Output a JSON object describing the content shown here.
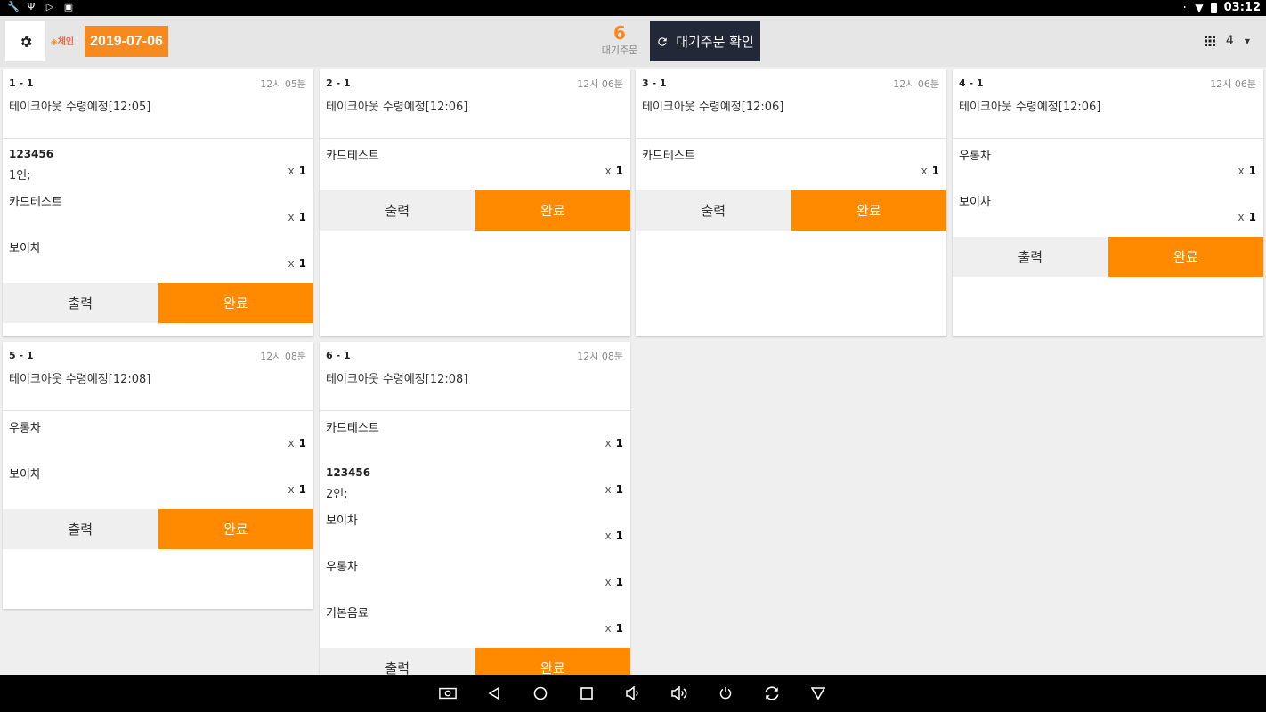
{
  "statusbar": {
    "left_icons": [
      "wrench-icon",
      "usb-icon",
      "play-store-icon",
      "app-icon"
    ],
    "right_icons": [
      "bluetooth-icon",
      "wifi-icon",
      "battery-icon"
    ],
    "time": "03:12"
  },
  "header": {
    "settings_icon": "gear-icon",
    "logo_text": "체인",
    "date": "2019-07-06",
    "pending_count": "6",
    "pending_label": "대기주문",
    "confirm_label": "대기주문 확인",
    "confirm_icon": "refresh-icon",
    "grid_value": "4",
    "grid_icon": "grid-icon"
  },
  "labels": {
    "qty_prefix": "x",
    "print": "출력",
    "done": "완료"
  },
  "orders": [
    {
      "number": "1 - 1",
      "time": "12시 05분",
      "desc": "테이크아웃 수령예정[12:05]",
      "items": [
        {
          "name": "123456",
          "option": "1인;",
          "qty": "1"
        },
        {
          "name": "카드테스트",
          "qty": "1"
        },
        {
          "name": "보이차",
          "qty": "1"
        }
      ]
    },
    {
      "number": "2 - 1",
      "time": "12시 06분",
      "desc": "테이크아웃 수령예정[12:06]",
      "items": [
        {
          "name": "카드테스트",
          "qty": "1"
        }
      ]
    },
    {
      "number": "3 - 1",
      "time": "12시 06분",
      "desc": "테이크아웃 수령예정[12:06]",
      "items": [
        {
          "name": "카드테스트",
          "qty": "1"
        }
      ]
    },
    {
      "number": "4 - 1",
      "time": "12시 06분",
      "desc": "테이크아웃 수령예정[12:06]",
      "items": [
        {
          "name": "우롱차",
          "qty": "1"
        },
        {
          "name": "보이차",
          "qty": "1"
        }
      ]
    },
    {
      "number": "5 - 1",
      "time": "12시 08분",
      "desc": "테이크아웃 수령예정[12:08]",
      "items": [
        {
          "name": "우롱차",
          "qty": "1"
        },
        {
          "name": "보이차",
          "qty": "1"
        }
      ]
    },
    {
      "number": "6 - 1",
      "time": "12시 08분",
      "desc": "테이크아웃 수령예정[12:08]",
      "items": [
        {
          "name": "카드테스트",
          "qty": "1"
        },
        {
          "name": "123456",
          "option": "2인;",
          "qty": "1"
        },
        {
          "name": "보이차",
          "qty": "1"
        },
        {
          "name": "우롱차",
          "qty": "1"
        },
        {
          "name": "기본음료",
          "qty": "1"
        }
      ]
    }
  ],
  "navbar": {
    "icons": [
      "screenshot-icon",
      "back-icon",
      "home-icon",
      "recents-icon",
      "volume-down-icon",
      "volume-up-icon",
      "power-icon",
      "rotate-icon",
      "menu-down-icon"
    ]
  },
  "colors": {
    "accent": "#ff8a00",
    "confirm_bg": "#232838",
    "header_bg": "#e6e6e6"
  }
}
